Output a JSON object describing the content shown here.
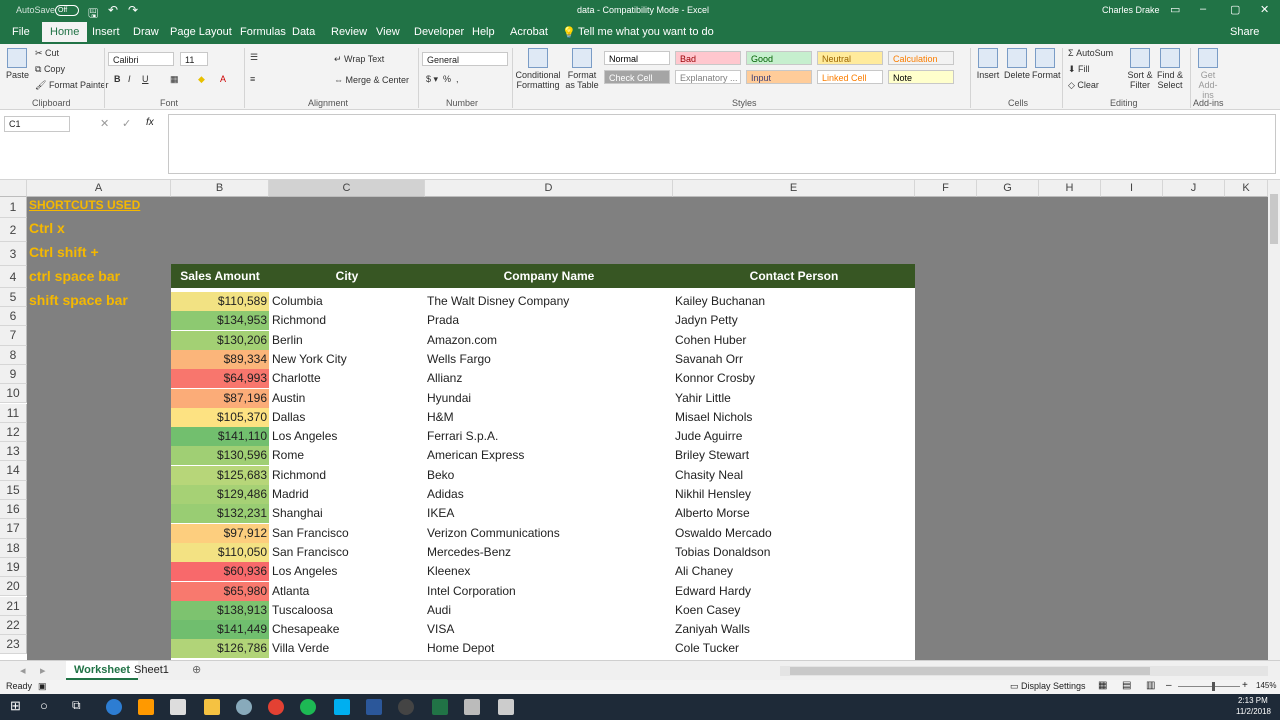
{
  "title": {
    "autosave": "AutoSave",
    "autosave_state": "Off",
    "doc": "data - Compatibility Mode - Excel",
    "user": "Charles Drake"
  },
  "tabs": [
    "File",
    "Home",
    "Insert",
    "Draw",
    "Page Layout",
    "Formulas",
    "Data",
    "Review",
    "View",
    "Developer",
    "Help",
    "Acrobat"
  ],
  "tell_me": "Tell me what you want to do",
  "share": "Share",
  "ribbon": {
    "clipboard": {
      "paste": "Paste",
      "cut": "Cut",
      "copy": "Copy",
      "format_painter": "Format Painter",
      "label": "Clipboard"
    },
    "font": {
      "name": "Calibri",
      "size": "11",
      "label": "Font"
    },
    "alignment": {
      "wrap": "Wrap Text",
      "merge": "Merge & Center",
      "label": "Alignment"
    },
    "number": {
      "format": "General",
      "label": "Number"
    },
    "styles": {
      "cond": "Conditional Formatting",
      "table": "Format as Table",
      "label": "Styles",
      "items": [
        {
          "t": "Normal",
          "bg": "#ffffff",
          "c": "#000000"
        },
        {
          "t": "Bad",
          "bg": "#ffc7ce",
          "c": "#9c0006"
        },
        {
          "t": "Good",
          "bg": "#c6efce",
          "c": "#006100"
        },
        {
          "t": "Neutral",
          "bg": "#ffeb9c",
          "c": "#9c6500"
        },
        {
          "t": "Calculation",
          "bg": "#f2f2f2",
          "c": "#fa7d00"
        },
        {
          "t": "Check Cell",
          "bg": "#a5a5a5",
          "c": "#ffffff"
        },
        {
          "t": "Explanatory ...",
          "bg": "#ffffff",
          "c": "#7f7f7f"
        },
        {
          "t": "Input",
          "bg": "#ffcc99",
          "c": "#3f3f76"
        },
        {
          "t": "Linked Cell",
          "bg": "#ffffff",
          "c": "#fa7d00"
        },
        {
          "t": "Note",
          "bg": "#ffffcc",
          "c": "#000000"
        }
      ]
    },
    "cells": {
      "insert": "Insert",
      "delete": "Delete",
      "format": "Format",
      "label": "Cells"
    },
    "editing": {
      "autosum": "AutoSum",
      "fill": "Fill",
      "clear": "Clear",
      "sort": "Sort & Filter",
      "find": "Find & Select",
      "label": "Editing"
    },
    "addins": {
      "get": "Get Add-ins",
      "label": "Add-ins"
    }
  },
  "formula": {
    "namebox": "C1",
    "fx": "fx",
    "value": ""
  },
  "columns": [
    "A",
    "B",
    "C",
    "D",
    "E",
    "F",
    "G",
    "H",
    "I",
    "J",
    "K"
  ],
  "colA": [
    "SHORTCUTS USED",
    "Ctrl x",
    "Ctrl shift +",
    "ctrl space bar",
    "shift space bar"
  ],
  "headers": [
    "Sales Amount",
    "City",
    "Company Name",
    "Contact Person"
  ],
  "rows": [
    [
      "$110,589",
      "Columbia",
      "The Walt Disney Company",
      "Kailey Buchanan",
      "#f2e283"
    ],
    [
      "$134,953",
      "Richmond",
      "Prada",
      "Jadyn Petty",
      "#8dc971"
    ],
    [
      "$130,206",
      "Berlin",
      "Amazon.com",
      "Cohen Huber",
      "#a3d074"
    ],
    [
      "$89,334",
      "New York City",
      "Wells Fargo",
      "Savanah Orr",
      "#fbb57a"
    ],
    [
      "$64,993",
      "Charlotte",
      "Allianz",
      "Konnor Crosby",
      "#f8766d"
    ],
    [
      "$87,196",
      "Austin",
      "Hyundai",
      "Yahir Little",
      "#fbac78"
    ],
    [
      "$105,370",
      "Dallas",
      "H&M",
      "Misael Nichols",
      "#fde282"
    ],
    [
      "$141,110",
      "Los Angeles",
      "Ferrari S.p.A.",
      "Jude Aguirre",
      "#72bf6e"
    ],
    [
      "$130,596",
      "Rome",
      "American Express",
      "Briley Stewart",
      "#a0cf74"
    ],
    [
      "$125,683",
      "Richmond",
      "Beko",
      "Chasity Neal",
      "#b7d679"
    ],
    [
      "$129,486",
      "Madrid",
      "Adidas",
      "Nikhil Hensley",
      "#a6d175"
    ],
    [
      "$132,231",
      "Shanghai",
      "IKEA",
      "Alberto Morse",
      "#99cd73"
    ],
    [
      "$97,912",
      "San Francisco",
      "Verizon Communications",
      "Oswaldo Mercado",
      "#fdce7e"
    ],
    [
      "$110,050",
      "San Francisco",
      "Mercedes-Benz",
      "Tobias Donaldson",
      "#f3e283"
    ],
    [
      "$60,936",
      "Los Angeles",
      "Kleenex",
      "Ali Chaney",
      "#f8696b"
    ],
    [
      "$65,980",
      "Atlanta",
      "Intel Corporation",
      "Edward Hardy",
      "#f8796e"
    ],
    [
      "$138,913",
      "Tuscaloosa",
      "Audi",
      "Koen Casey",
      "#7dc36f"
    ],
    [
      "$141,449",
      "Chesapeake",
      "VISA",
      "Zaniyah Walls",
      "#70be6e"
    ],
    [
      "$126,786",
      "Villa Verde",
      "Home Depot",
      "Cole Tucker",
      "#b1d478"
    ]
  ],
  "sheets": [
    "Worksheet",
    "Sheet1"
  ],
  "status": {
    "ready": "Ready",
    "display": "Display Settings",
    "zoom": "145%"
  },
  "clock": {
    "time": "2:13 PM",
    "date": "11/2/2018"
  }
}
